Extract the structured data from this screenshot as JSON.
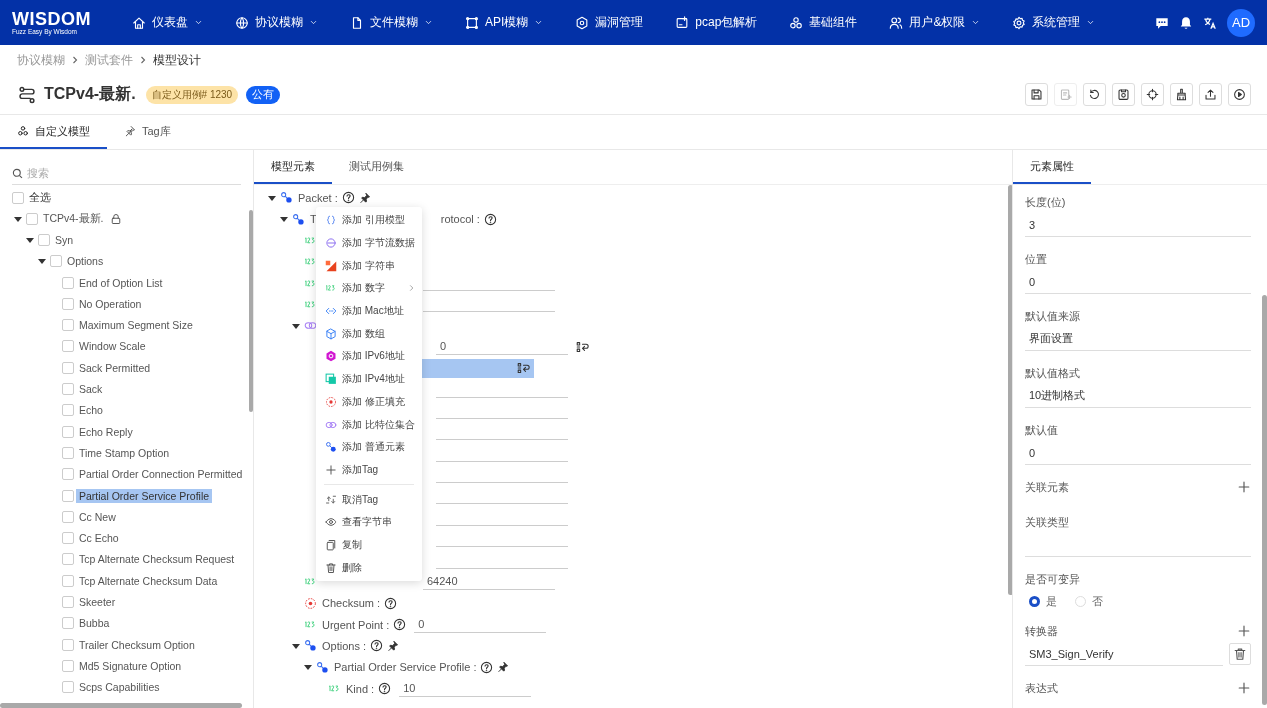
{
  "nav": {
    "logo": "WISDOM",
    "slogan": "Fuzz Easy By Wisdom",
    "avatar": "AD",
    "items": [
      {
        "label": "仪表盘",
        "kind": "home",
        "dropdown": true
      },
      {
        "label": "协议模糊",
        "kind": "globe",
        "dropdown": true
      },
      {
        "label": "文件模糊",
        "kind": "file",
        "dropdown": true
      },
      {
        "label": "API模糊",
        "kind": "api",
        "dropdown": true
      },
      {
        "label": "漏洞管理",
        "kind": "bug",
        "dropdown": false
      },
      {
        "label": "pcap包解析",
        "kind": "pcap",
        "dropdown": false
      },
      {
        "label": "基础组件",
        "kind": "circles",
        "dropdown": false
      },
      {
        "label": "用户&权限",
        "kind": "users",
        "dropdown": true
      },
      {
        "label": "系统管理",
        "kind": "gear",
        "dropdown": true
      }
    ]
  },
  "breadcrumb": [
    {
      "label": "协议模糊",
      "current": false
    },
    {
      "label": "测试套件",
      "current": false
    },
    {
      "label": "模型设计",
      "current": true
    }
  ],
  "title": {
    "text": "TCPv4-最新.",
    "badge": "自定义用例# 1230",
    "tag": "公有"
  },
  "toolbar": [
    {
      "kind": "save",
      "disabled": false
    },
    {
      "kind": "paste",
      "disabled": true
    },
    {
      "kind": "undo",
      "disabled": false
    },
    {
      "kind": "clipboard",
      "disabled": false
    },
    {
      "kind": "target",
      "disabled": false
    },
    {
      "kind": "broom",
      "disabled": false
    },
    {
      "kind": "export",
      "disabled": false
    },
    {
      "kind": "play",
      "disabled": false
    }
  ],
  "left_tabs": [
    {
      "label": "自定义模型",
      "kind": "cluster",
      "selected": true
    },
    {
      "label": "Tag库",
      "kind": "pin",
      "selected": false
    }
  ],
  "search": {
    "placeholder": "搜索"
  },
  "select_all": {
    "label": "全选",
    "checked": false
  },
  "tree": [
    {
      "label": "TCPv4-最新.",
      "expanded": true,
      "checked": false,
      "selected": false,
      "children": [
        {
          "label": "Syn",
          "expanded": true,
          "checked": false,
          "selected": false,
          "children": [
            {
              "label": "Options",
              "expanded": true,
              "checked": false,
              "selected": false,
              "children": [
                {
                  "label": "End of Option List",
                  "checked": false,
                  "selected": false
                },
                {
                  "label": "No Operation",
                  "checked": false,
                  "selected": false
                },
                {
                  "label": "Maximum Segment Size",
                  "checked": false,
                  "selected": false
                },
                {
                  "label": "Window Scale",
                  "checked": false,
                  "selected": false
                },
                {
                  "label": "Sack Permitted",
                  "checked": false,
                  "selected": false
                },
                {
                  "label": "Sack",
                  "checked": false,
                  "selected": false
                },
                {
                  "label": "Echo",
                  "checked": false,
                  "selected": false
                },
                {
                  "label": "Echo Reply",
                  "checked": false,
                  "selected": false
                },
                {
                  "label": "Time Stamp Option",
                  "checked": false,
                  "selected": false
                },
                {
                  "label": "Partial Order Connection Permitted",
                  "checked": false,
                  "selected": false
                },
                {
                  "label": "Partial Order Service Profile",
                  "checked": false,
                  "selected": true
                },
                {
                  "label": "Cc New",
                  "checked": false,
                  "selected": false
                },
                {
                  "label": "Cc Echo",
                  "checked": false,
                  "selected": false
                },
                {
                  "label": "Tcp Alternate Checksum Request",
                  "checked": false,
                  "selected": false
                },
                {
                  "label": "Tcp Alternate Checksum Data",
                  "checked": false,
                  "selected": false
                },
                {
                  "label": "Skeeter",
                  "checked": false,
                  "selected": false
                },
                {
                  "label": "Bubba",
                  "checked": false,
                  "selected": false
                },
                {
                  "label": "Trailer Checksum Option",
                  "checked": false,
                  "selected": false
                },
                {
                  "label": "Md5 Signature Option",
                  "checked": false,
                  "selected": false
                },
                {
                  "label": "Scps Capabilities",
                  "checked": false,
                  "selected": false
                }
              ]
            }
          ]
        }
      ]
    }
  ],
  "middle_tabs": [
    {
      "label": "模型元素",
      "selected": true
    },
    {
      "label": "测试用例集",
      "selected": false
    }
  ],
  "elements": [
    {
      "kind": "group",
      "label": "Packet :",
      "help": true,
      "pinned": true,
      "expanded": true,
      "selected": false,
      "children": [
        {
          "kind": "group",
          "label": "T",
          "label_tail": "rotocol :",
          "help": true,
          "pinned": false,
          "expanded": true,
          "selected": false,
          "children": [
            {
              "kind": "number",
              "selected": false
            },
            {
              "kind": "number",
              "selected": false
            },
            {
              "kind": "number",
              "field": true,
              "selected": false
            },
            {
              "kind": "number",
              "field": true,
              "selected": false
            },
            {
              "kind": "bitset",
              "expanded": true,
              "selected": false,
              "children": [
                {
                  "kind": "hidden",
                  "value": "0",
                  "reset": true,
                  "selected": false
                },
                {
                  "kind": "hidden",
                  "reset": true,
                  "selected": true
                },
                {
                  "kind": "hidden",
                  "field": true,
                  "selected": false
                },
                {
                  "kind": "hidden",
                  "field": true,
                  "selected": false
                },
                {
                  "kind": "hidden",
                  "field": true,
                  "selected": false
                },
                {
                  "kind": "hidden",
                  "field": true,
                  "selected": false
                },
                {
                  "kind": "hidden",
                  "field": true,
                  "selected": false
                },
                {
                  "kind": "hidden",
                  "field": true,
                  "selected": false
                },
                {
                  "kind": "hidden",
                  "field": true,
                  "selected": false
                },
                {
                  "kind": "hidden",
                  "field": true,
                  "selected": false
                },
                {
                  "kind": "hidden",
                  "field": true,
                  "selected": false
                }
              ]
            },
            {
              "kind": "number",
              "value": "64240",
              "selected": false
            },
            {
              "kind": "fixup",
              "label": "Checksum :",
              "help": true,
              "selected": false
            },
            {
              "kind": "number",
              "label": "Urgent Point :",
              "help": true,
              "value": "0",
              "selected": false
            },
            {
              "kind": "group",
              "label": "Options :",
              "help": true,
              "pinned": true,
              "expanded": true,
              "selected": false,
              "children": [
                {
                  "kind": "group",
                  "label": "Partial Order Service Profile :",
                  "help": true,
                  "pinned": true,
                  "expanded": true,
                  "selected": false,
                  "children": [
                    {
                      "kind": "number",
                      "label": "Kind :",
                      "help": true,
                      "value": "10",
                      "selected": false
                    }
                  ]
                }
              ]
            }
          ]
        }
      ]
    }
  ],
  "context_menu": {
    "groups": [
      [
        {
          "kind": "brace",
          "label": "添加 引用模型",
          "submenu": false
        },
        {
          "kind": "bytes",
          "label": "添加 字节流数据",
          "submenu": false
        },
        {
          "kind": "string",
          "label": "添加 字符串",
          "submenu": false
        },
        {
          "kind": "number",
          "label": "添加 数字",
          "submenu": true
        },
        {
          "kind": "mac",
          "label": "添加 Mac地址",
          "submenu": false
        },
        {
          "kind": "array",
          "label": "添加 数组",
          "submenu": false
        },
        {
          "kind": "ipv6",
          "label": "添加 IPv6地址",
          "submenu": false
        },
        {
          "kind": "ipv4",
          "label": "添加 IPv4地址",
          "submenu": false
        },
        {
          "kind": "fixup",
          "label": "添加 修正填充",
          "submenu": false
        },
        {
          "kind": "bitset",
          "label": "添加 比特位集合",
          "submenu": false
        },
        {
          "kind": "element",
          "label": "添加 普通元素",
          "submenu": false
        },
        {
          "kind": "plus",
          "label": "添加Tag",
          "submenu": false
        }
      ],
      [
        {
          "kind": "untag",
          "label": "取消Tag",
          "submenu": false
        },
        {
          "kind": "eye",
          "label": "查看字节串",
          "submenu": false
        },
        {
          "kind": "copy",
          "label": "复制",
          "submenu": false
        },
        {
          "kind": "trash",
          "label": "删除",
          "submenu": false
        }
      ]
    ]
  },
  "properties": {
    "tab": "元素属性",
    "fields": [
      {
        "kind": "input",
        "label": "长度(位)",
        "value": "3"
      },
      {
        "kind": "input",
        "label": "位置",
        "value": "0"
      },
      {
        "kind": "input",
        "label": "默认值来源",
        "value": "界面设置"
      },
      {
        "kind": "input",
        "label": "默认值格式",
        "value": "10进制格式"
      },
      {
        "kind": "input",
        "label": "默认值",
        "value": "0"
      },
      {
        "kind": "add",
        "label": "关联元素"
      },
      {
        "kind": "input",
        "label": "关联类型"
      },
      {
        "kind": "radio",
        "label": "是否可变异",
        "options": [
          {
            "label": "是",
            "selected": true
          },
          {
            "label": "否",
            "selected": false
          }
        ]
      },
      {
        "kind": "list",
        "label": "转换器",
        "value": "SM3_Sign_Verify"
      },
      {
        "kind": "add",
        "label": "表达式"
      }
    ]
  }
}
